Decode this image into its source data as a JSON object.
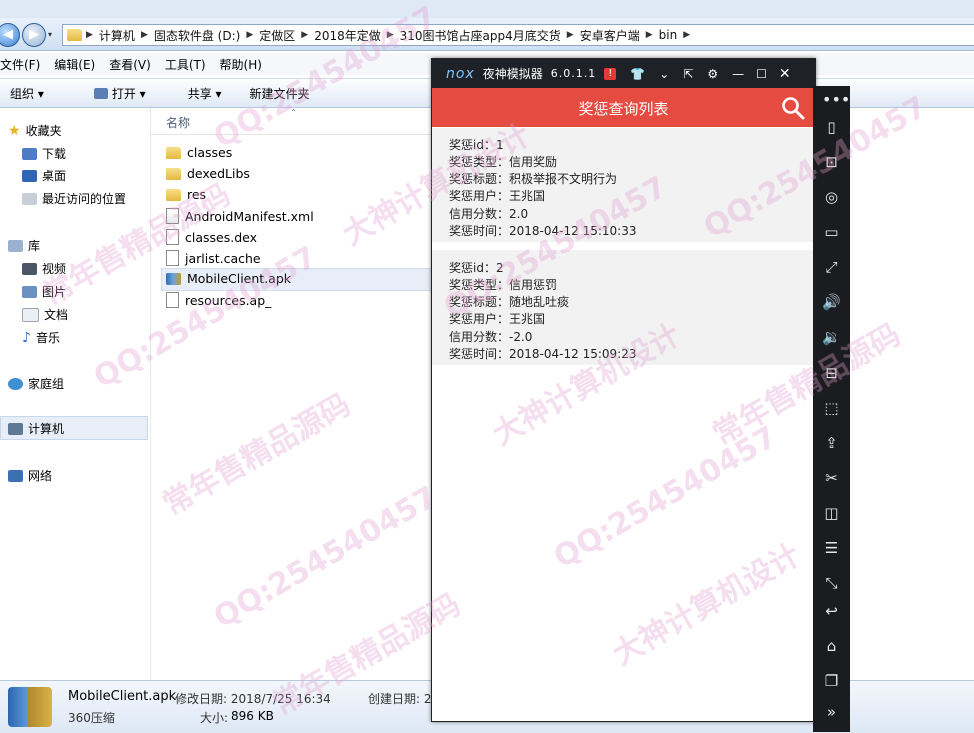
{
  "explorer": {
    "path": [
      "计算机",
      "固态软件盘 (D:)",
      "定做区",
      "2018年定做",
      "310图书馆占座app4月底交货",
      "安卓客户端",
      "bin"
    ],
    "menu": [
      "文件(F)",
      "编辑(E)",
      "查看(V)",
      "工具(T)",
      "帮助(H)"
    ],
    "toolbar": {
      "organize": "组织 ▾",
      "open": "打开 ▾",
      "share": "共享 ▾",
      "new_folder": "新建文件夹"
    },
    "sidebar": {
      "favorites": "收藏夹",
      "downloads": "下载",
      "desktop": "桌面",
      "recent": "最近访问的位置",
      "libraries": "库",
      "videos": "视频",
      "pictures": "图片",
      "documents": "文档",
      "music": "音乐",
      "homegroup": "家庭组",
      "computer": "计算机",
      "network": "网络"
    },
    "column_name": "名称",
    "files": [
      "classes",
      "dexedLibs",
      "res",
      "AndroidManifest.xml",
      "classes.dex",
      "jarlist.cache",
      "MobileClient.apk",
      "resources.ap_"
    ],
    "details": {
      "name": "MobileClient.apk",
      "type": "360压缩",
      "modified": "修改日期: 2018/7/25 16:34",
      "created": "创建日期: 2",
      "size_label": "大小:",
      "size": "896 KB"
    }
  },
  "emulator": {
    "logo": "nox",
    "title": "夜神模拟器",
    "version": "6.0.1.1",
    "header": "奖惩查询列表",
    "labels": {
      "id": "奖惩id：",
      "type": "奖惩类型：",
      "title": "奖惩标题：",
      "user": "奖惩用户：",
      "score": "信用分数：",
      "time": "奖惩时间："
    },
    "records": [
      {
        "id": "1",
        "type": "信用奖励",
        "title": "积极举报不文明行为",
        "user": "王兆国",
        "score": "2.0",
        "time": "2018-04-12 15:10:33"
      },
      {
        "id": "2",
        "type": "信用惩罚",
        "title": "随地乱吐痰",
        "user": "王兆国",
        "score": "-2.0",
        "time": "2018-04-12 15:09:23"
      }
    ],
    "accent": "#e64b41"
  },
  "watermarks": [
    "QQ:254540457",
    "大神计算机设计",
    "常年售精品源码"
  ]
}
